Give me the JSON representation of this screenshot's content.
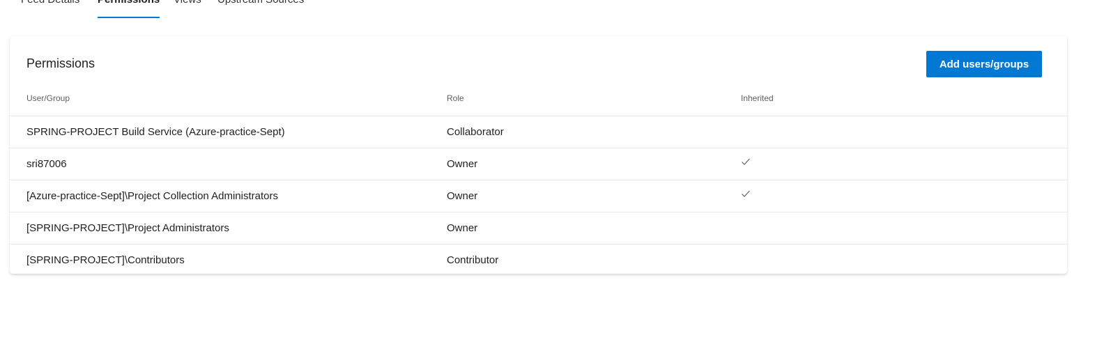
{
  "tabs": [
    {
      "label": "Feed Details",
      "active": false
    },
    {
      "label": "Permissions",
      "active": true
    },
    {
      "label": "Views",
      "active": false
    },
    {
      "label": "Upstream Sources",
      "active": false
    }
  ],
  "accent_color": "#0078d4",
  "card": {
    "title": "Permissions",
    "add_button_label": "Add users/groups"
  },
  "columns": {
    "user": "User/Group",
    "role": "Role",
    "inherited": "Inherited"
  },
  "rows": [
    {
      "user": "SPRING-PROJECT Build Service (Azure-practice-Sept)",
      "role": "Collaborator",
      "inherited": false
    },
    {
      "user": "sri87006",
      "role": "Owner",
      "inherited": true
    },
    {
      "user": "[Azure-practice-Sept]\\Project Collection Administrators",
      "role": "Owner",
      "inherited": true
    },
    {
      "user": "[SPRING-PROJECT]\\Project Administrators",
      "role": "Owner",
      "inherited": false
    },
    {
      "user": "[SPRING-PROJECT]\\Contributors",
      "role": "Contributor",
      "inherited": false
    }
  ]
}
